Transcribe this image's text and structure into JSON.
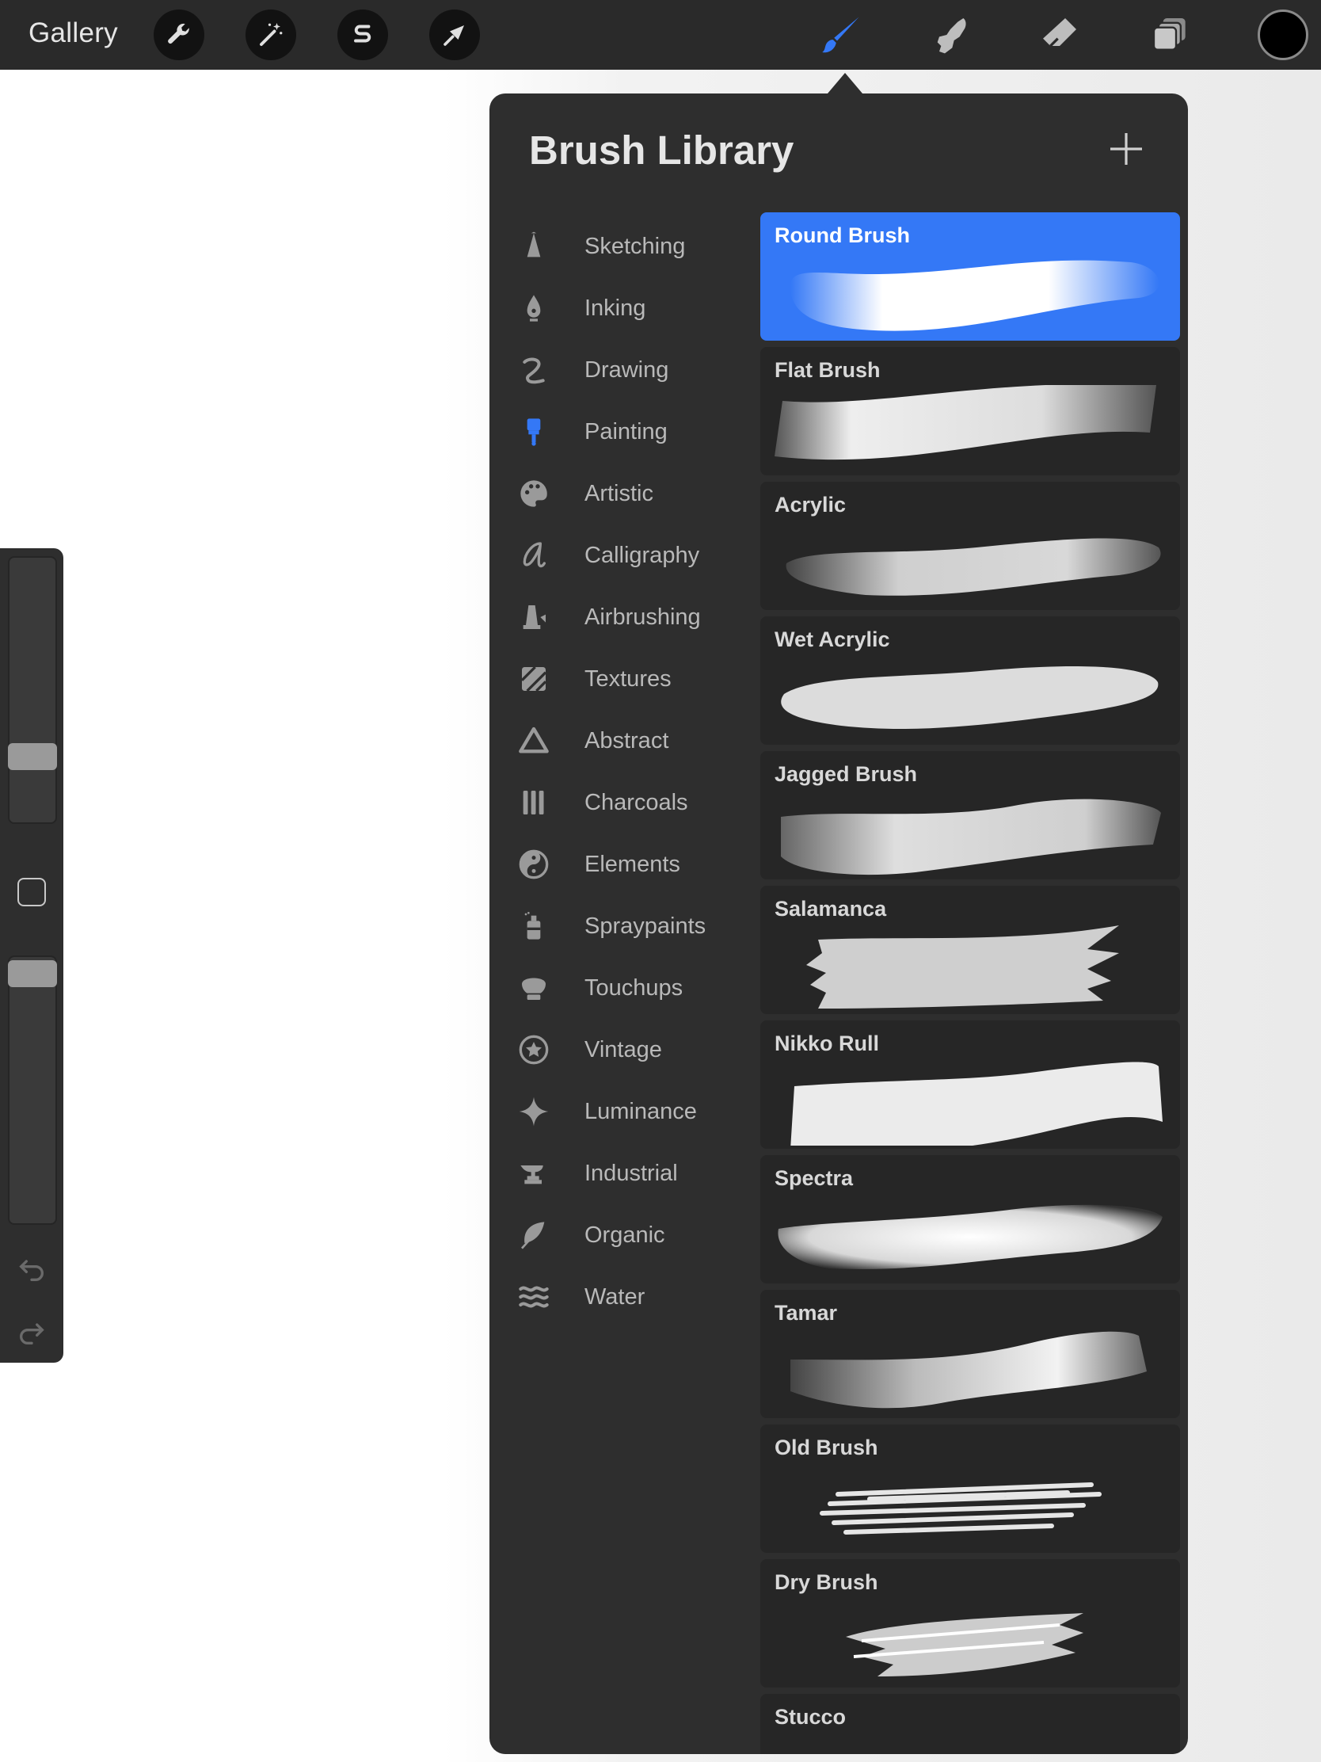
{
  "topbar": {
    "gallery_label": "Gallery",
    "left_tools": [
      "wrench-icon",
      "magic-wand-icon",
      "selection-s-icon",
      "transform-arrow-icon"
    ],
    "right_tools": [
      "brush-icon",
      "smudge-icon",
      "eraser-icon",
      "layers-icon"
    ],
    "active_tool": "brush",
    "current_color": "#000000"
  },
  "panel": {
    "title": "Brush Library",
    "add_icon": "plus-icon",
    "categories": [
      {
        "label": "Sketching",
        "icon": "pencil-tip-icon"
      },
      {
        "label": "Inking",
        "icon": "pen-nib-icon"
      },
      {
        "label": "Drawing",
        "icon": "squiggle-icon"
      },
      {
        "label": "Painting",
        "icon": "paintbrush-icon",
        "selected": true
      },
      {
        "label": "Artistic",
        "icon": "palette-icon"
      },
      {
        "label": "Calligraphy",
        "icon": "calligraphy-a-icon"
      },
      {
        "label": "Airbrushing",
        "icon": "airbrush-icon"
      },
      {
        "label": "Textures",
        "icon": "texture-icon"
      },
      {
        "label": "Abstract",
        "icon": "triangle-icon"
      },
      {
        "label": "Charcoals",
        "icon": "charcoal-sticks-icon"
      },
      {
        "label": "Elements",
        "icon": "yin-yang-icon"
      },
      {
        "label": "Spraypaints",
        "icon": "spray-can-icon"
      },
      {
        "label": "Touchups",
        "icon": "touchup-brush-icon"
      },
      {
        "label": "Vintage",
        "icon": "star-badge-icon"
      },
      {
        "label": "Luminance",
        "icon": "sparkle-icon"
      },
      {
        "label": "Industrial",
        "icon": "anvil-icon"
      },
      {
        "label": "Organic",
        "icon": "leaf-icon"
      },
      {
        "label": "Water",
        "icon": "waves-icon"
      }
    ],
    "brushes": [
      {
        "name": "Round Brush",
        "selected": true
      },
      {
        "name": "Flat Brush"
      },
      {
        "name": "Acrylic"
      },
      {
        "name": "Wet Acrylic"
      },
      {
        "name": "Jagged Brush"
      },
      {
        "name": "Salamanca"
      },
      {
        "name": "Nikko Rull"
      },
      {
        "name": "Spectra"
      },
      {
        "name": "Tamar"
      },
      {
        "name": "Old Brush"
      },
      {
        "name": "Dry Brush"
      },
      {
        "name": "Stucco"
      }
    ]
  },
  "colors": {
    "accent": "#3478f6",
    "toolbar_bg": "#2a2a2a",
    "panel_bg": "#2e2e2e",
    "brush_card_bg": "#262626"
  }
}
